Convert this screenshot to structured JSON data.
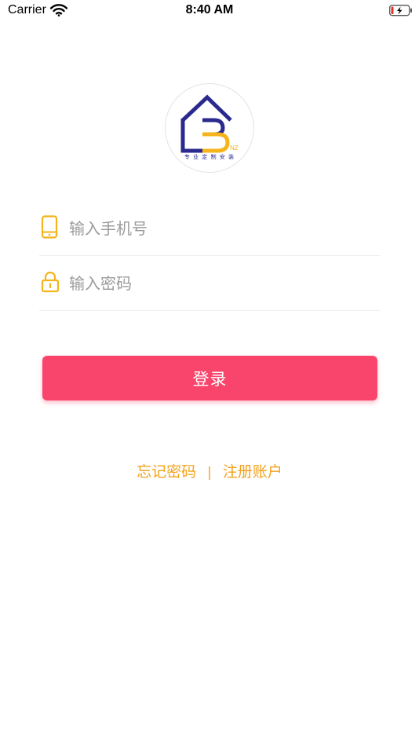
{
  "status_bar": {
    "carrier": "Carrier",
    "time": "8:40 AM"
  },
  "logo": {
    "tagline": "专 业 定 制 安 装",
    "mark_letter": "B",
    "region": "NZ",
    "colors": {
      "navy": "#2a2a8e",
      "gold": "#f4b41a"
    }
  },
  "form": {
    "phone": {
      "placeholder": "输入手机号",
      "value": "",
      "icon": "phone-icon"
    },
    "password": {
      "placeholder": "输入密码",
      "value": "",
      "icon": "lock-icon"
    }
  },
  "login_button": {
    "label": "登录",
    "color": "#f9456b"
  },
  "links": {
    "forgot_password": "忘记密码",
    "separator": "|",
    "register": "注册账户",
    "color": "#f4a21d"
  }
}
